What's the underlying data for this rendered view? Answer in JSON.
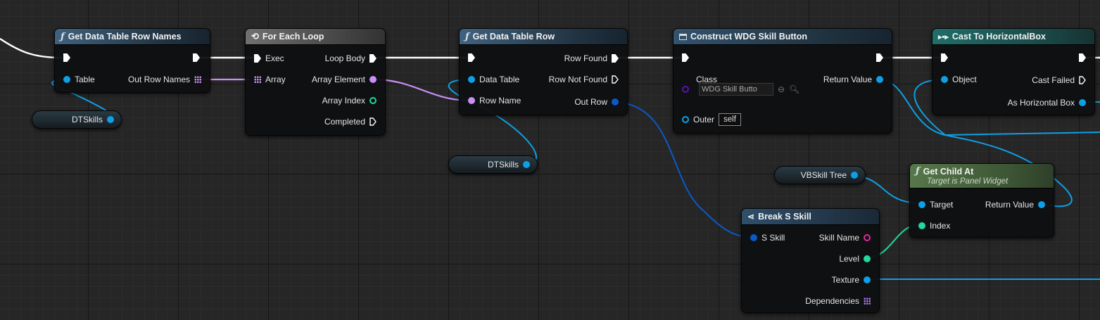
{
  "nodes": {
    "get_row_names": {
      "title": "Get Data Table Row Names",
      "pins": {
        "table": "Table",
        "out_row_names": "Out Row Names"
      }
    },
    "for_each": {
      "title": "For Each Loop",
      "pins": {
        "exec": "Exec",
        "array": "Array",
        "loop_body": "Loop Body",
        "array_element": "Array Element",
        "array_index": "Array Index",
        "completed": "Completed"
      }
    },
    "get_row": {
      "title": "Get Data Table Row",
      "pins": {
        "data_table": "Data Table",
        "row_name": "Row Name",
        "row_found": "Row Found",
        "row_not_found": "Row Not Found",
        "out_row": "Out Row"
      }
    },
    "construct": {
      "title": "Construct WDG Skill Button",
      "pins": {
        "class": "Class",
        "class_value": "WDG Skill Butto",
        "outer": "Outer",
        "outer_value": "self",
        "return_value": "Return Value"
      }
    },
    "cast": {
      "title": "Cast To HorizontalBox",
      "pins": {
        "object": "Object",
        "cast_failed": "Cast Failed",
        "as_hbox": "As Horizontal Box"
      }
    },
    "get_child": {
      "title": "Get Child At",
      "subtitle": "Target is Panel Widget",
      "pins": {
        "target": "Target",
        "index": "Index",
        "return_value": "Return Value"
      }
    },
    "break_skill": {
      "title": "Break S Skill",
      "pins": {
        "s_skill": "S Skill",
        "skill_name": "Skill Name",
        "level": "Level",
        "texture": "Texture",
        "dependencies": "Dependencies"
      }
    }
  },
  "variables": {
    "dtskills_1": "DTSkills",
    "dtskills_2": "DTSkills",
    "vbskill_tree": "VBSkill Tree"
  },
  "colors": {
    "exec_wire": "#ffffff",
    "object_pin": "#0ea0e6",
    "struct_pin": "#0a59c9",
    "name_pin": "#c98ff5",
    "int_pin": "#20d8a0",
    "text_pin": "#e1299a"
  },
  "icons": {
    "function": "function-icon",
    "loop": "loop-macro-icon",
    "construct": "construct-object-icon",
    "cast": "cast-icon",
    "break": "break-struct-icon"
  }
}
